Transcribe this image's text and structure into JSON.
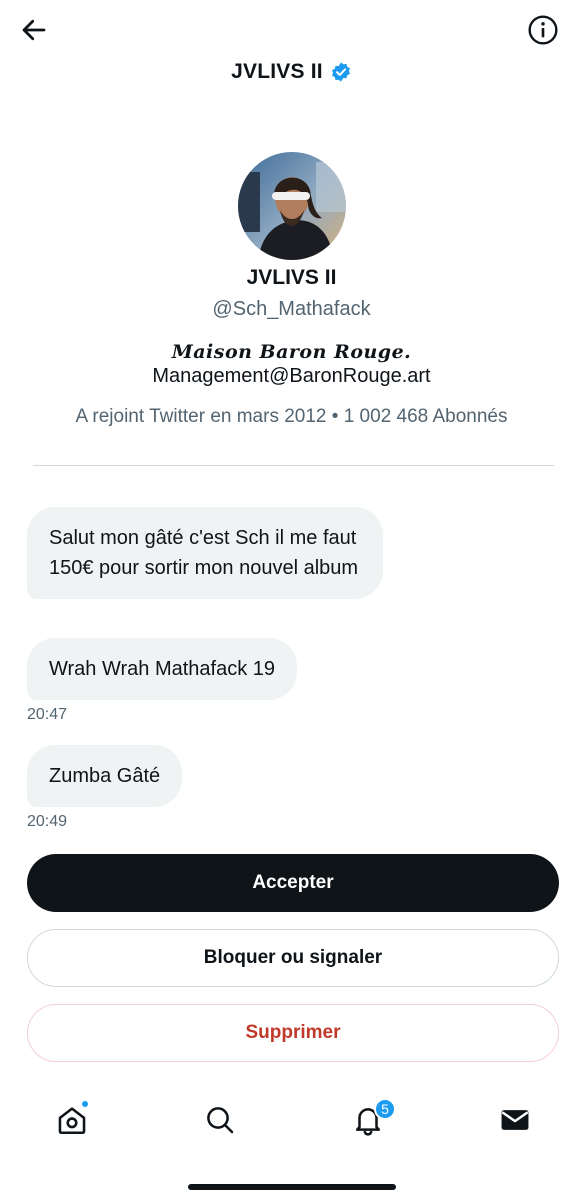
{
  "header": {
    "title": "JVLIVS II",
    "back_icon": "arrow-left-icon",
    "info_icon": "info-circle-icon",
    "verified_icon": "verified-badge-icon"
  },
  "profile": {
    "avatar_icon": "avatar",
    "name": "JVLIVS II",
    "handle": "@Sch_Mathafack",
    "bio_brand": "Maison Baron Rouge.",
    "bio_mail": "Management@BaronRouge.art",
    "meta": "A rejoint Twitter en mars 2012 • 1 002 468 Abonnés"
  },
  "messages": [
    {
      "text": "Salut mon gâté c'est Sch il me faut 150€ pour sortir mon nouvel album",
      "time": ""
    },
    {
      "text": "Wrah Wrah Mathafack 19",
      "time": "20:47"
    },
    {
      "text": "Zumba Gâté",
      "time": "20:49"
    }
  ],
  "actions": {
    "accept": "Accepter",
    "block": "Bloquer ou signaler",
    "delete": "Supprimer"
  },
  "tabbar": {
    "home_icon": "home-icon",
    "search_icon": "search-icon",
    "notifications_icon": "bell-icon",
    "notifications_count": "5",
    "messages_icon": "envelope-icon"
  },
  "colors": {
    "accent": "#1d9bf0",
    "danger": "#c0392b",
    "primary_button": "#0f1419",
    "bubble": "#eff3f4"
  }
}
